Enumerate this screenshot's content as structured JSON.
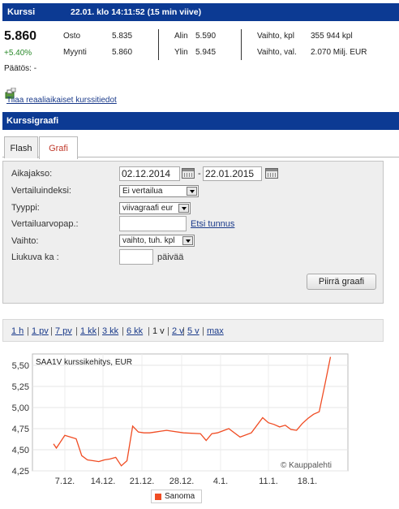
{
  "header": {
    "title": "Kurssi",
    "timestamp": "22.01. klo 14:11:52 (15 min viive)"
  },
  "quote": {
    "price": "5.860",
    "change": "+5.40%",
    "paatos": "Päätös: -",
    "osto_label": "Osto",
    "osto_value": "5.835",
    "myynti_label": "Myynti",
    "myynti_value": "5.860",
    "alin_label": "Alin",
    "alin_value": "5.590",
    "ylin_label": "Ylin",
    "ylin_value": "5.945",
    "vaihto_kpl_label": "Vaihto, kpl",
    "vaihto_kpl_value": "355 944 kpl",
    "vaihto_val_label": "Vaihto, val.",
    "vaihto_val_value": "2.070 Milj. EUR"
  },
  "subscribe": {
    "link": "Tilaa reaaliaikaiset kurssitiedot",
    "icon": "subscribe-icon"
  },
  "graph_section": {
    "title": "Kurssigraafi"
  },
  "tabs": [
    {
      "label": "Flash"
    },
    {
      "label": "Grafi",
      "active": true
    }
  ],
  "form": {
    "aikajakso_label": "Aikajakso:",
    "date_from": "02.12.2014",
    "date_sep": "-",
    "date_to": "22.01.2015",
    "vertailuindeksi_label": "Vertailuindeksi:",
    "vertailuindeksi_value": "Ei vertailua",
    "tyyppi_label": "Tyyppi:",
    "tyyppi_value": "viivagraafi eur",
    "vertailuarvopap_label": "Vertailuarvopap.:",
    "vertailuarvopap_value": "",
    "etsi_link": "Etsi tunnus",
    "vaihto_label": "Vaihto:",
    "vaihto_value": "vaihto, tuh. kpl",
    "liukuva_label": "Liukuva ka :",
    "liukuva_value": "",
    "liukuva_unit": "päivää",
    "submit": "Piirrä graafi"
  },
  "ranges": [
    "1 h",
    "1 pv",
    "7 pv",
    "1 kk",
    "3 kk",
    "6 kk",
    "1 v",
    "2 v",
    "5 v",
    "max"
  ],
  "range_separator": "|",
  "active_range": "1 v",
  "colors": {
    "brand": "#0c3a93",
    "series": "#f04c23",
    "link": "#1a3a8a",
    "positive": "#2a8a2a"
  },
  "chart_data": {
    "type": "line",
    "title": "SAA1V kurssikehitys, EUR",
    "watermark": "© Kauppalehti",
    "y_ticks": [
      "5,50",
      "5,25",
      "5,00",
      "4,75",
      "4,50",
      "4,25"
    ],
    "x_ticks": [
      "7.12.",
      "14.12.",
      "21.12.",
      "28.12.",
      "4.1.",
      "11.1.",
      "18.1."
    ],
    "ylim": [
      4.25,
      5.6
    ],
    "grid": true,
    "legend_position": "bottom",
    "series": [
      {
        "name": "Sanoma",
        "color": "#f04c23",
        "x": [
          2.0,
          2.5,
          3.0,
          4.0,
          5.0,
          6.0,
          7.0,
          8.0,
          9.0,
          10.0,
          11.0,
          12.0,
          13.0,
          14.0,
          15.0,
          16.0,
          17.0,
          18.0,
          19.0,
          20.0,
          21.0,
          22.0,
          25.0,
          28.0,
          29.0,
          30.0,
          31.0,
          33.0,
          35.0,
          37.0,
          39.0,
          40.0,
          41.0,
          42.0,
          43.0,
          44.0,
          45.0,
          46.0,
          47.0,
          48.0,
          49.0,
          50.0,
          51.0
        ],
        "y": [
          4.57,
          4.52,
          4.57,
          4.67,
          4.65,
          4.63,
          4.43,
          4.38,
          4.37,
          4.36,
          4.38,
          4.39,
          4.41,
          4.31,
          4.37,
          4.78,
          4.71,
          4.7,
          4.7,
          4.71,
          4.72,
          4.73,
          4.7,
          4.69,
          4.61,
          4.69,
          4.7,
          4.75,
          4.65,
          4.7,
          4.88,
          4.82,
          4.8,
          4.77,
          4.79,
          4.74,
          4.73,
          4.81,
          4.87,
          4.92,
          4.95,
          5.27,
          5.6
        ]
      }
    ]
  }
}
